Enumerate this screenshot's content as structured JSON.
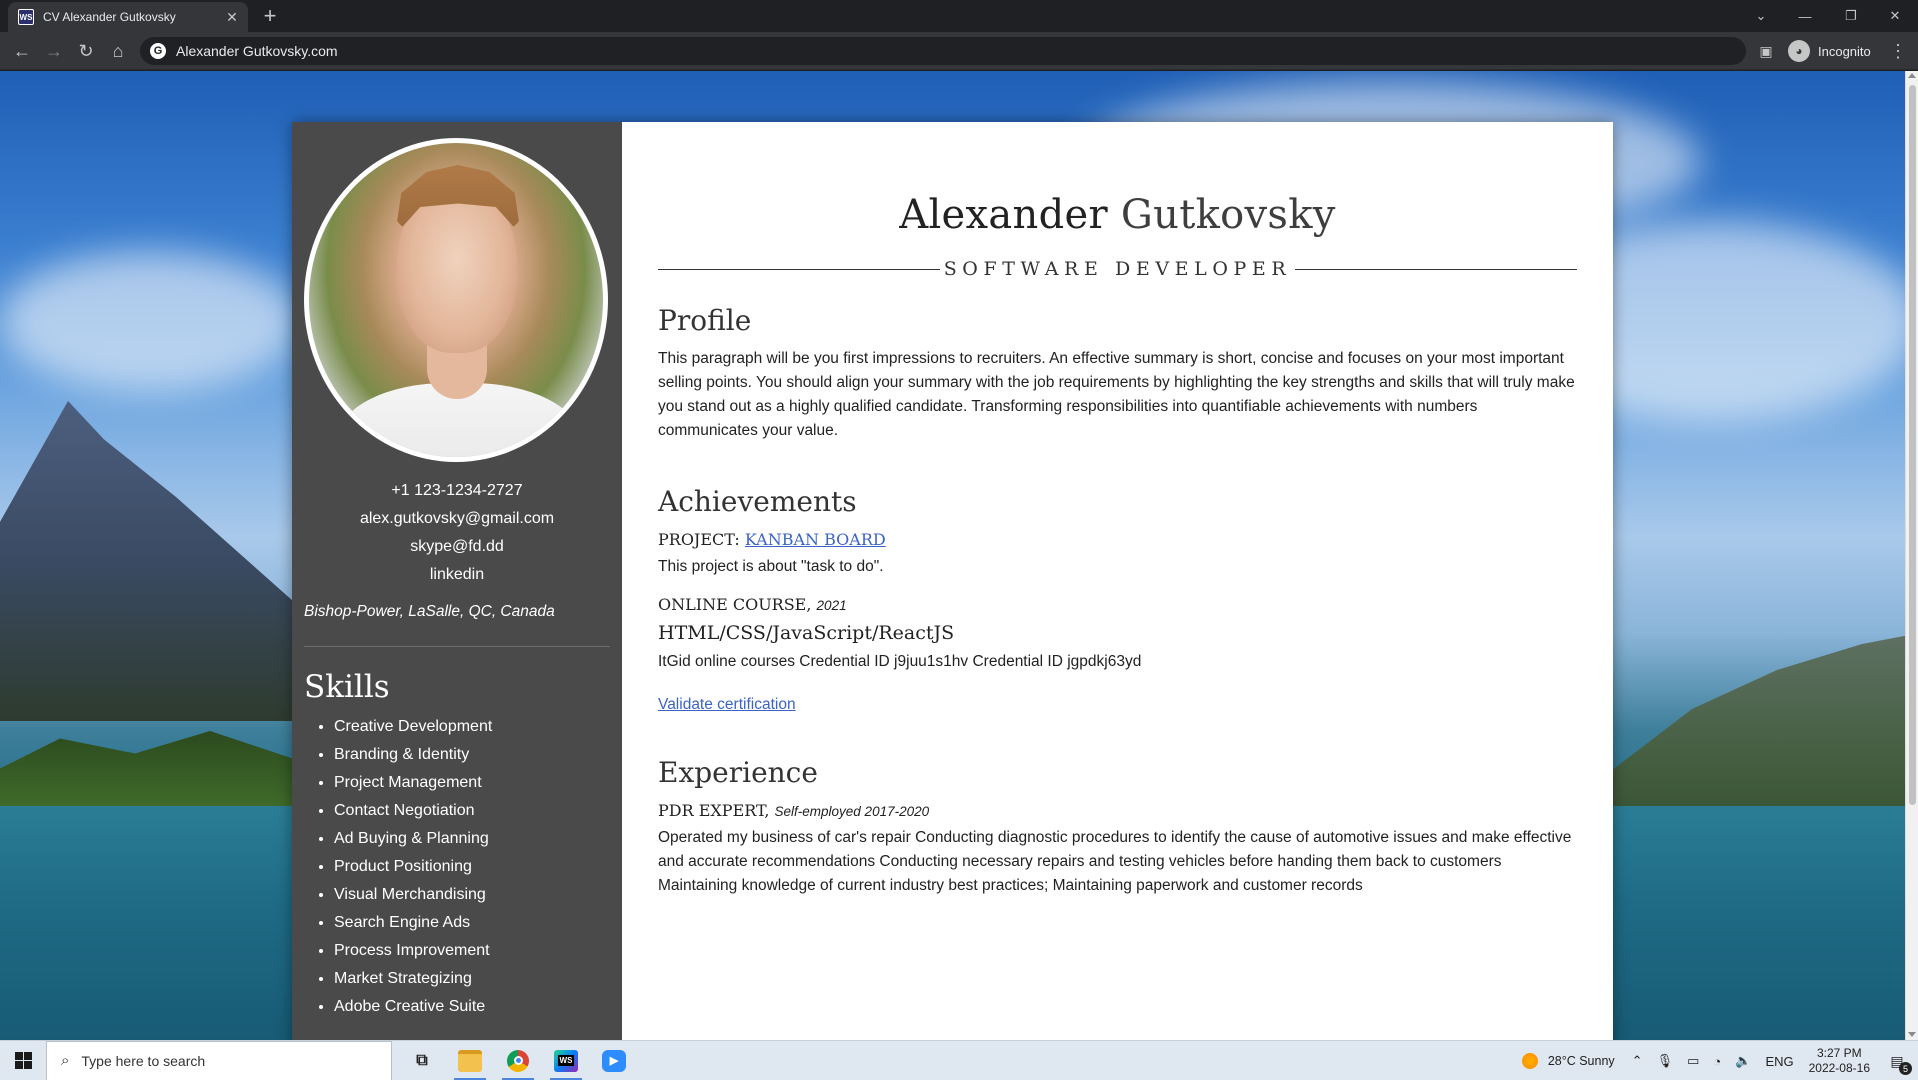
{
  "browser": {
    "tab_title": "CV Alexander Gutkovsky",
    "tab_favicon": "WS",
    "url": "Alexander Gutkovsky.com",
    "incognito_label": "Incognito"
  },
  "cv": {
    "first_name": "Alexander",
    "last_name": "Gutkovsky",
    "role": "SOFTWARE DEVELOPER",
    "contact": {
      "phone": "+1 123-1234-2727",
      "email": "alex.gutkovsky@gmail.com",
      "skype": "skype@fd.dd",
      "linkedin": "linkedin",
      "location": "Bishop-Power, LaSalle, QC, Canada"
    },
    "skills_title": "Skills",
    "skills": [
      "Creative Development",
      "Branding & Identity",
      "Project Management",
      "Contact Negotiation",
      "Ad Buying & Planning",
      "Product Positioning",
      "Visual Merchandising",
      "Search Engine Ads",
      "Process Improvement",
      "Market Strategizing",
      "Adobe Creative Suite"
    ],
    "profile": {
      "title": "Profile",
      "text": "This paragraph will be you first impressions to recruiters. An effective summary is short, concise and focuses on your most important selling points. You should align your summary with the job requirements by highlighting the key strengths and skills that will truly make you stand out as a highly qualified candidate. Transforming responsibilities into quantifiable achievements with numbers communicates your value."
    },
    "achievements": {
      "title": "Achievements",
      "project_label": "PROJECT:",
      "project_link": "KANBAN BOARD",
      "project_desc": "This project is about \"task to do\".",
      "course_label": "ONLINE COURSE,",
      "course_year": "2021",
      "course_name": "HTML/CSS/JavaScript/ReactJS",
      "course_desc": "ItGid online courses Credential ID j9juu1s1hv Credential ID jgpdkj63yd",
      "validate_link": "Validate certification"
    },
    "experience": {
      "title": "Experience",
      "company": "PDR EXPERT,",
      "period": "Self-employed 2017-2020",
      "desc": "Operated my business of car's repair Conducting diagnostic procedures to identify the cause of automotive issues and make effective and accurate recommendations Conducting necessary repairs and testing vehicles before handing them back to customers Maintaining knowledge of current industry best practices; Maintaining paperwork and customer records"
    }
  },
  "taskbar": {
    "search_placeholder": "Type here to search",
    "weather": "28°C  Sunny",
    "lang": "ENG",
    "time": "3:27 PM",
    "date": "2022-08-16",
    "notification_count": "5"
  }
}
